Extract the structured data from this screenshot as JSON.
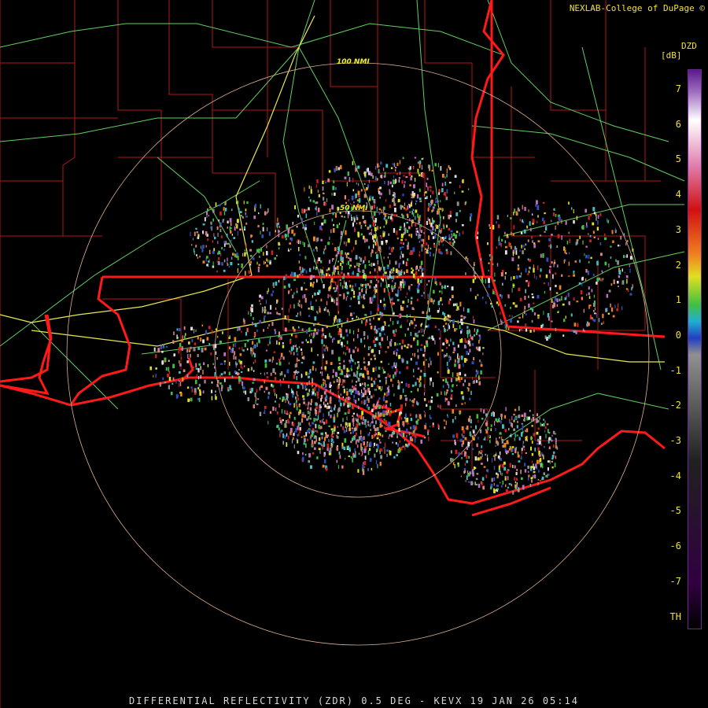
{
  "header": {
    "credit": "NEXLAB-College of DuPage ©"
  },
  "range_rings": [
    {
      "label": "100 NMI"
    },
    {
      "label": "50 NMI"
    }
  ],
  "legend": {
    "product": "DZD",
    "unit": "[dB]",
    "ticks": [
      "7",
      "6",
      "5",
      "4",
      "3",
      "2",
      "1",
      "0",
      "-1",
      "-2",
      "-3",
      "-4",
      "-5",
      "-6",
      "-7",
      "TH"
    ],
    "colors": {
      "top": "#5a1a8a",
      "violet": "#a070c0",
      "white": "#ffffff",
      "pink": "#e080b0",
      "red": "#d01010",
      "orange": "#f08020",
      "yellow": "#e0e020",
      "green": "#40c040",
      "cyan": "#20b0d0",
      "blue": "#2040c0",
      "gray": "#909090",
      "dark": "#202020",
      "purple": "#300040"
    }
  },
  "map": {
    "colors": {
      "state_border": "#ff1a1a",
      "county": "#b01818",
      "highway": "#60d060",
      "interstate": "#e8e850",
      "ring": "#e0b090"
    }
  },
  "footer": {
    "caption": "DIFFERENTIAL REFLECTIVITY (ZDR) 0.5 DEG - KEVX 19 JAN 26 05:14"
  }
}
